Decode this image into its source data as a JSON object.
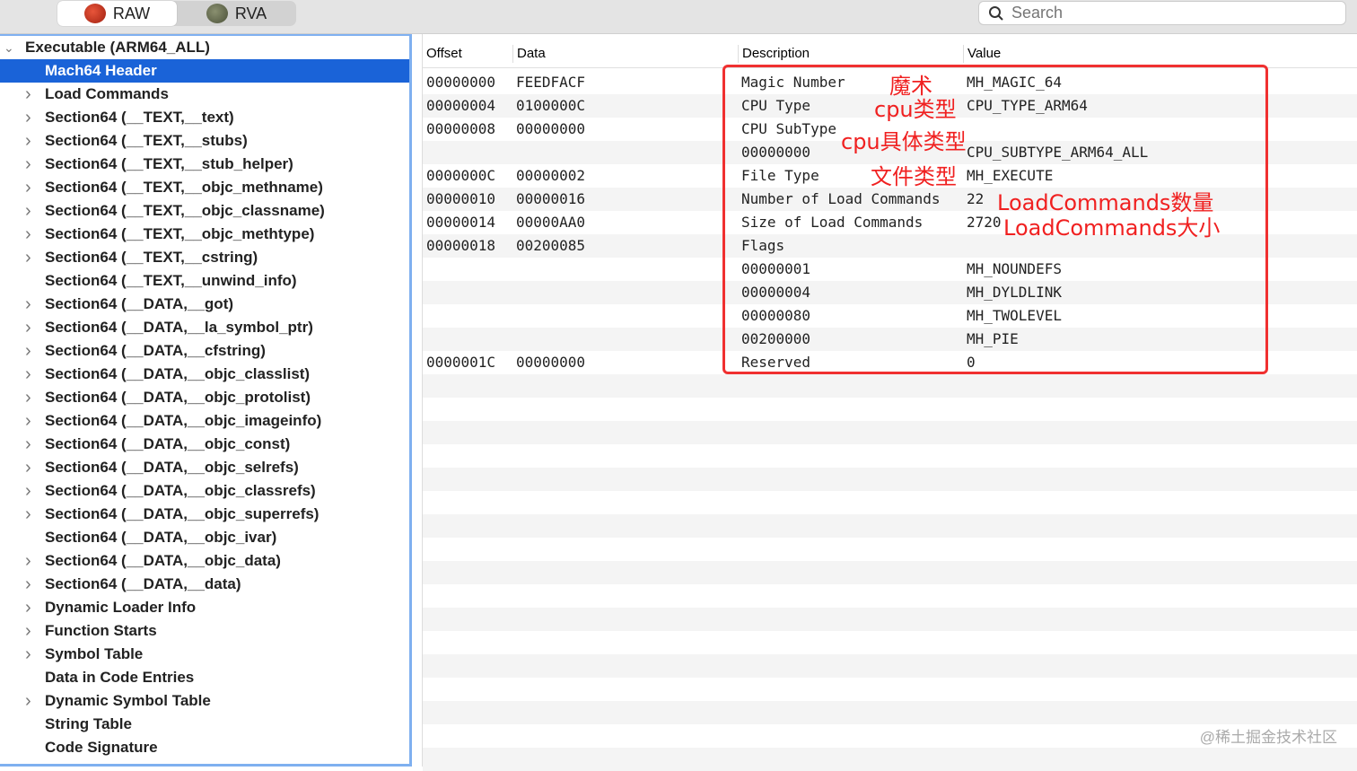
{
  "toolbar": {
    "raw_label": "RAW",
    "rva_label": "RVA",
    "search_placeholder": "Search"
  },
  "sidebar": {
    "root": "Executable  (ARM64_ALL)",
    "items": [
      {
        "label": "Mach64 Header",
        "expandable": false,
        "selected": true
      },
      {
        "label": "Load Commands",
        "expandable": true
      },
      {
        "label": "Section64 (__TEXT,__text)",
        "expandable": true
      },
      {
        "label": "Section64 (__TEXT,__stubs)",
        "expandable": true
      },
      {
        "label": "Section64 (__TEXT,__stub_helper)",
        "expandable": true
      },
      {
        "label": "Section64 (__TEXT,__objc_methname)",
        "expandable": true
      },
      {
        "label": "Section64 (__TEXT,__objc_classname)",
        "expandable": true
      },
      {
        "label": "Section64 (__TEXT,__objc_methtype)",
        "expandable": true
      },
      {
        "label": "Section64 (__TEXT,__cstring)",
        "expandable": true
      },
      {
        "label": "Section64 (__TEXT,__unwind_info)",
        "expandable": false
      },
      {
        "label": "Section64 (__DATA,__got)",
        "expandable": true
      },
      {
        "label": "Section64 (__DATA,__la_symbol_ptr)",
        "expandable": true
      },
      {
        "label": "Section64 (__DATA,__cfstring)",
        "expandable": true
      },
      {
        "label": "Section64 (__DATA,__objc_classlist)",
        "expandable": true
      },
      {
        "label": "Section64 (__DATA,__objc_protolist)",
        "expandable": true
      },
      {
        "label": "Section64 (__DATA,__objc_imageinfo)",
        "expandable": true
      },
      {
        "label": "Section64 (__DATA,__objc_const)",
        "expandable": true
      },
      {
        "label": "Section64 (__DATA,__objc_selrefs)",
        "expandable": true
      },
      {
        "label": "Section64 (__DATA,__objc_classrefs)",
        "expandable": true
      },
      {
        "label": "Section64 (__DATA,__objc_superrefs)",
        "expandable": true
      },
      {
        "label": "Section64 (__DATA,__objc_ivar)",
        "expandable": false
      },
      {
        "label": "Section64 (__DATA,__objc_data)",
        "expandable": true
      },
      {
        "label": "Section64 (__DATA,__data)",
        "expandable": true
      },
      {
        "label": "Dynamic Loader Info",
        "expandable": true
      },
      {
        "label": "Function Starts",
        "expandable": true
      },
      {
        "label": "Symbol Table",
        "expandable": true
      },
      {
        "label": "Data in Code Entries",
        "expandable": false
      },
      {
        "label": "Dynamic Symbol Table",
        "expandable": true
      },
      {
        "label": "String Table",
        "expandable": false
      },
      {
        "label": "Code Signature",
        "expandable": false
      }
    ]
  },
  "table": {
    "headers": [
      "Offset",
      "Data",
      "Description",
      "Value"
    ],
    "rows": [
      [
        "00000000",
        "FEEDFACF",
        "Magic Number",
        "MH_MAGIC_64"
      ],
      [
        "00000004",
        "0100000C",
        "CPU Type",
        "CPU_TYPE_ARM64"
      ],
      [
        "00000008",
        "00000000",
        "CPU SubType",
        ""
      ],
      [
        "",
        "",
        "00000000",
        "CPU_SUBTYPE_ARM64_ALL"
      ],
      [
        "0000000C",
        "00000002",
        "File Type",
        "MH_EXECUTE"
      ],
      [
        "00000010",
        "00000016",
        "Number of Load Commands",
        "22"
      ],
      [
        "00000014",
        "00000AA0",
        "Size of Load Commands",
        "2720"
      ],
      [
        "00000018",
        "00200085",
        "Flags",
        ""
      ],
      [
        "",
        "",
        "00000001",
        "MH_NOUNDEFS"
      ],
      [
        "",
        "",
        "00000004",
        "MH_DYLDLINK"
      ],
      [
        "",
        "",
        "00000080",
        "MH_TWOLEVEL"
      ],
      [
        "",
        "",
        "00200000",
        "MH_PIE"
      ],
      [
        "0000001C",
        "00000000",
        "Reserved",
        "0"
      ]
    ]
  },
  "annotations": {
    "magic": "魔术",
    "cpu_type": "cpu类型",
    "cpu_subtype": "cpu具体类型",
    "file_type": "文件类型",
    "ncmds": "LoadCommands数量",
    "sizeofcmds": "LoadCommands大小"
  },
  "watermark": "@稀土掘金技术社区",
  "colors": {
    "selection": "#1a63d8",
    "annotation": "#f02020"
  }
}
